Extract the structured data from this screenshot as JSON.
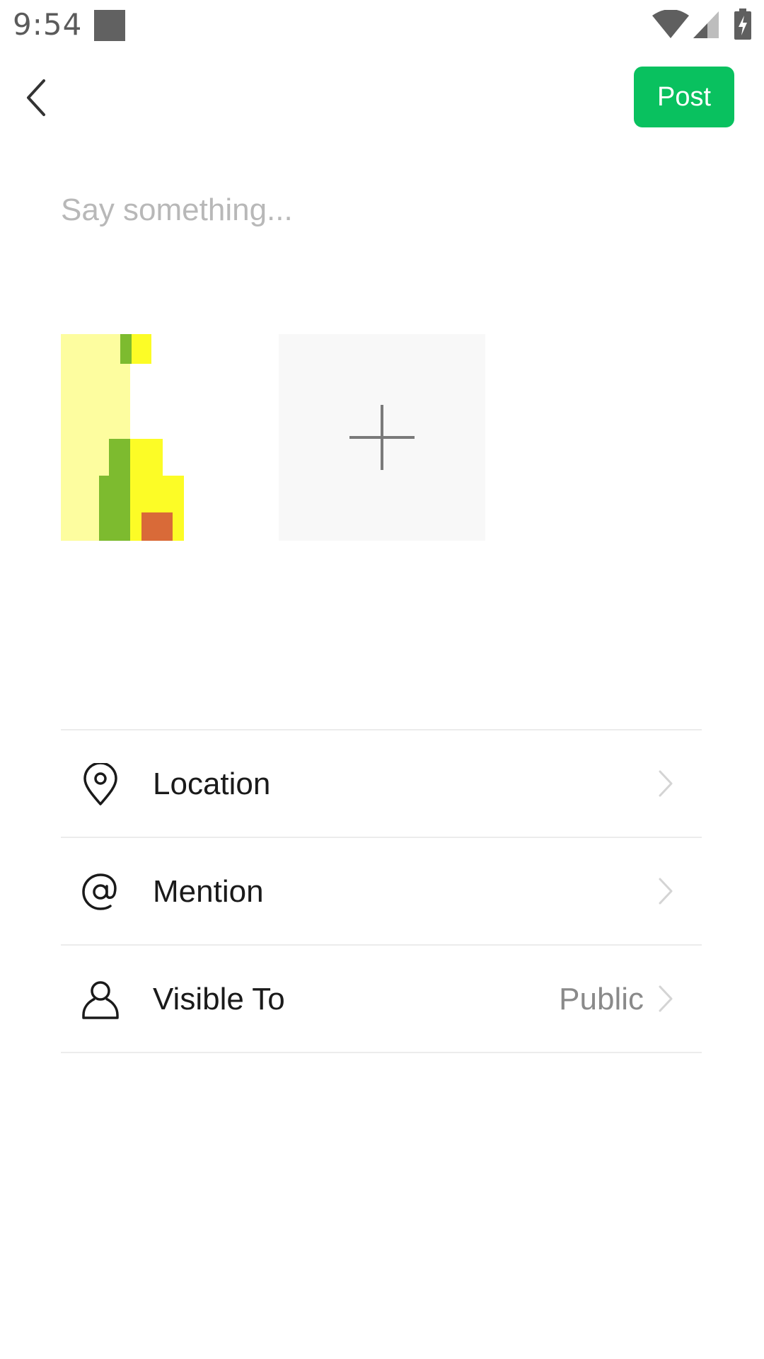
{
  "status_bar": {
    "time": "9:54",
    "icons": [
      "notification-square-icon",
      "wifi-icon",
      "cell-signal-icon",
      "battery-charging-icon"
    ]
  },
  "app_bar": {
    "back_icon": "chevron-left-icon",
    "post_label": "Post"
  },
  "composer": {
    "placeholder": "Say something...",
    "value": ""
  },
  "media": {
    "thumbnails": [
      "image-thumbnail"
    ],
    "add_icon": "plus-icon"
  },
  "options": [
    {
      "label": "Location",
      "icon": "location-pin-icon",
      "value": ""
    },
    {
      "label": "Mention",
      "icon": "at-sign-icon",
      "value": ""
    },
    {
      "label": "Visible To",
      "icon": "person-icon",
      "value": "Public"
    }
  ],
  "colors": {
    "accent": "#09c15f",
    "placeholder": "#b8b8b8",
    "divider": "#ececec",
    "secondary_text": "#8a8a8a"
  }
}
